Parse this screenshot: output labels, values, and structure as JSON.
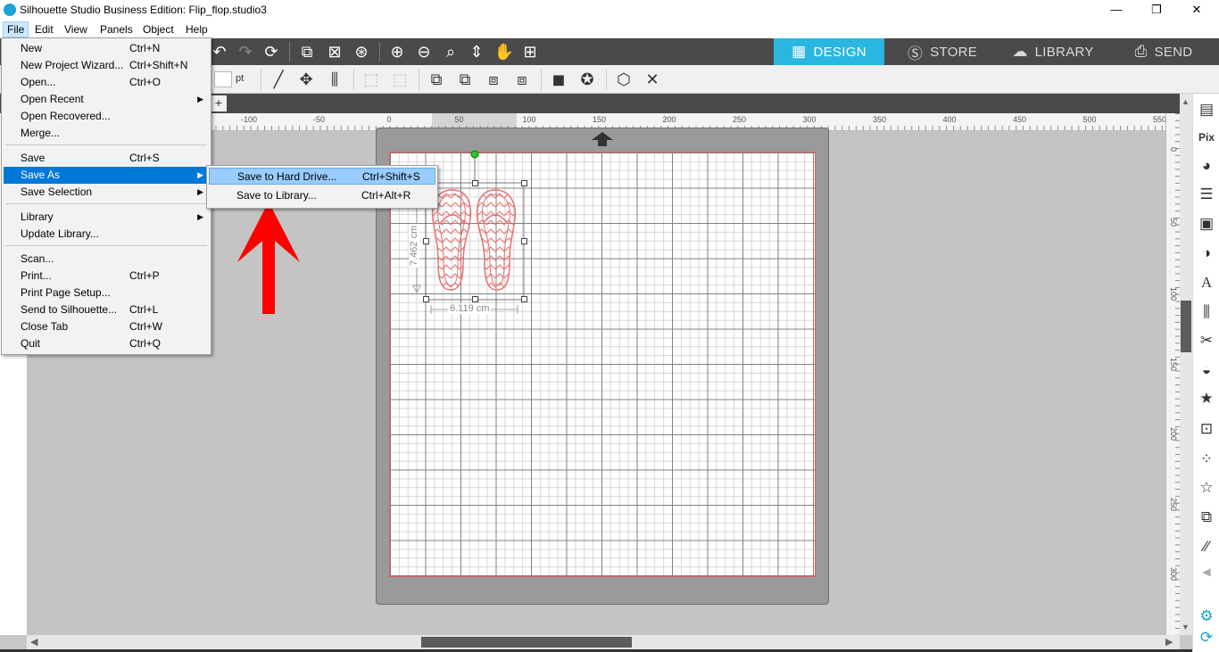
{
  "window": {
    "title": "Silhouette Studio Business Edition: Flip_flop.studio3",
    "minimize": "—",
    "restore": "❐",
    "close": "✕"
  },
  "menubar": [
    "File",
    "Edit",
    "View",
    "Panels",
    "Object",
    "Help"
  ],
  "nav_tabs": [
    {
      "label": "DESIGN",
      "icon": "grid-icon",
      "active": true
    },
    {
      "label": "STORE",
      "icon": "silhouette-s-icon",
      "active": false
    },
    {
      "label": "LIBRARY",
      "icon": "cloud-icon",
      "active": false
    },
    {
      "label": "SEND",
      "icon": "cutter-icon",
      "active": false
    }
  ],
  "toolbar2": {
    "unit_label": "pt"
  },
  "ruler": {
    "horizontal_labels": [
      "-100",
      "-50",
      "0",
      "50",
      "100",
      "150",
      "200",
      "250",
      "300",
      "350",
      "400",
      "450",
      "500",
      "550"
    ],
    "vertical_labels": [
      "0",
      "50",
      "100",
      "150",
      "200",
      "250",
      "300"
    ]
  },
  "file_menu": [
    {
      "label": "New",
      "shortcut": "Ctrl+N"
    },
    {
      "label": "New Project Wizard...",
      "shortcut": "Ctrl+Shift+N"
    },
    {
      "label": "Open...",
      "shortcut": "Ctrl+O"
    },
    {
      "label": "Open Recent",
      "shortcut": "",
      "submenu": true
    },
    {
      "label": "Open Recovered...",
      "shortcut": ""
    },
    {
      "label": "Merge...",
      "shortcut": ""
    },
    {
      "label": "Save",
      "shortcut": "Ctrl+S"
    },
    {
      "label": "Save As",
      "shortcut": "",
      "submenu": true,
      "highlighted": true
    },
    {
      "label": "Save Selection",
      "shortcut": "",
      "submenu": true
    },
    {
      "label": "Library",
      "shortcut": "",
      "submenu": true
    },
    {
      "label": "Update Library...",
      "shortcut": ""
    },
    {
      "label": "Scan...",
      "shortcut": ""
    },
    {
      "label": "Print...",
      "shortcut": "Ctrl+P"
    },
    {
      "label": "Print Page Setup...",
      "shortcut": ""
    },
    {
      "label": "Send to Silhouette...",
      "shortcut": "Ctrl+L"
    },
    {
      "label": "Close Tab",
      "shortcut": "Ctrl+W"
    },
    {
      "label": "Quit",
      "shortcut": "Ctrl+Q"
    }
  ],
  "save_as_submenu": [
    {
      "label": "Save to Hard Drive...",
      "shortcut": "Ctrl+Shift+S",
      "highlighted": true
    },
    {
      "label": "Save to Library...",
      "shortcut": "Ctrl+Alt+R"
    }
  ],
  "selection": {
    "height_label": "7.462 cm",
    "width_label": "6.119 cm"
  },
  "annotation": {
    "arrow_color": "#ff0000"
  },
  "colors": {
    "accent": "#29b6e0",
    "toolbar": "#4a4a4a",
    "design_lines": "#e87070",
    "menu_highlight": "#0078d7"
  }
}
